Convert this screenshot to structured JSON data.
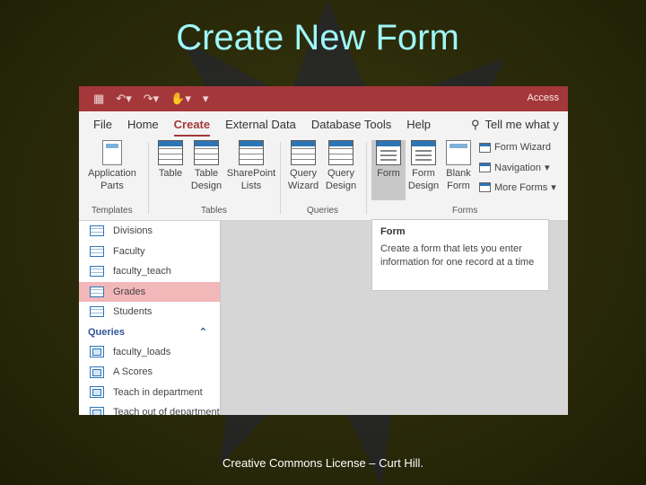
{
  "slide": {
    "title": "Create New Form",
    "footer": "Creative Commons License – Curt Hill."
  },
  "titlebar": {
    "app_name": "Access",
    "quick_access_icons": [
      "save-icon",
      "undo-icon",
      "redo-icon",
      "touch-mode-icon",
      "customize-qat-icon"
    ]
  },
  "menu": {
    "items": [
      "File",
      "Home",
      "Create",
      "External Data",
      "Database Tools",
      "Help"
    ],
    "active": "Create",
    "tell_me": "Tell me what y"
  },
  "ribbon": {
    "buttons": {
      "app_parts": "Application Parts",
      "table": "Table",
      "table_design": "Table Design",
      "sharepoint_lists": "SharePoint Lists",
      "query_wizard": "Query Wizard",
      "query_design": "Query Design",
      "form": "Form",
      "form_design": "Form Design",
      "blank_form": "Blank Form",
      "form_wizard": "Form Wizard",
      "navigation": "Navigation",
      "more_forms": "More Forms"
    },
    "groups": [
      "Templates",
      "Tables",
      "Queries",
      "Forms"
    ]
  },
  "tooltip": {
    "title": "Form",
    "text": "Create a form that lets you enter information for one record at a time"
  },
  "nav": {
    "tables": [
      "Divisions",
      "Faculty",
      "faculty_teach",
      "Grades",
      "Students"
    ],
    "selected": "Grades",
    "queries_header": "Queries",
    "queries": [
      "faculty_loads",
      "A Scores",
      "Teach in department",
      "Teach out of department"
    ]
  },
  "colors": {
    "title_text": "#9ff7f7",
    "access_red": "#a4373a",
    "selected_row": "#f2b7b9"
  }
}
